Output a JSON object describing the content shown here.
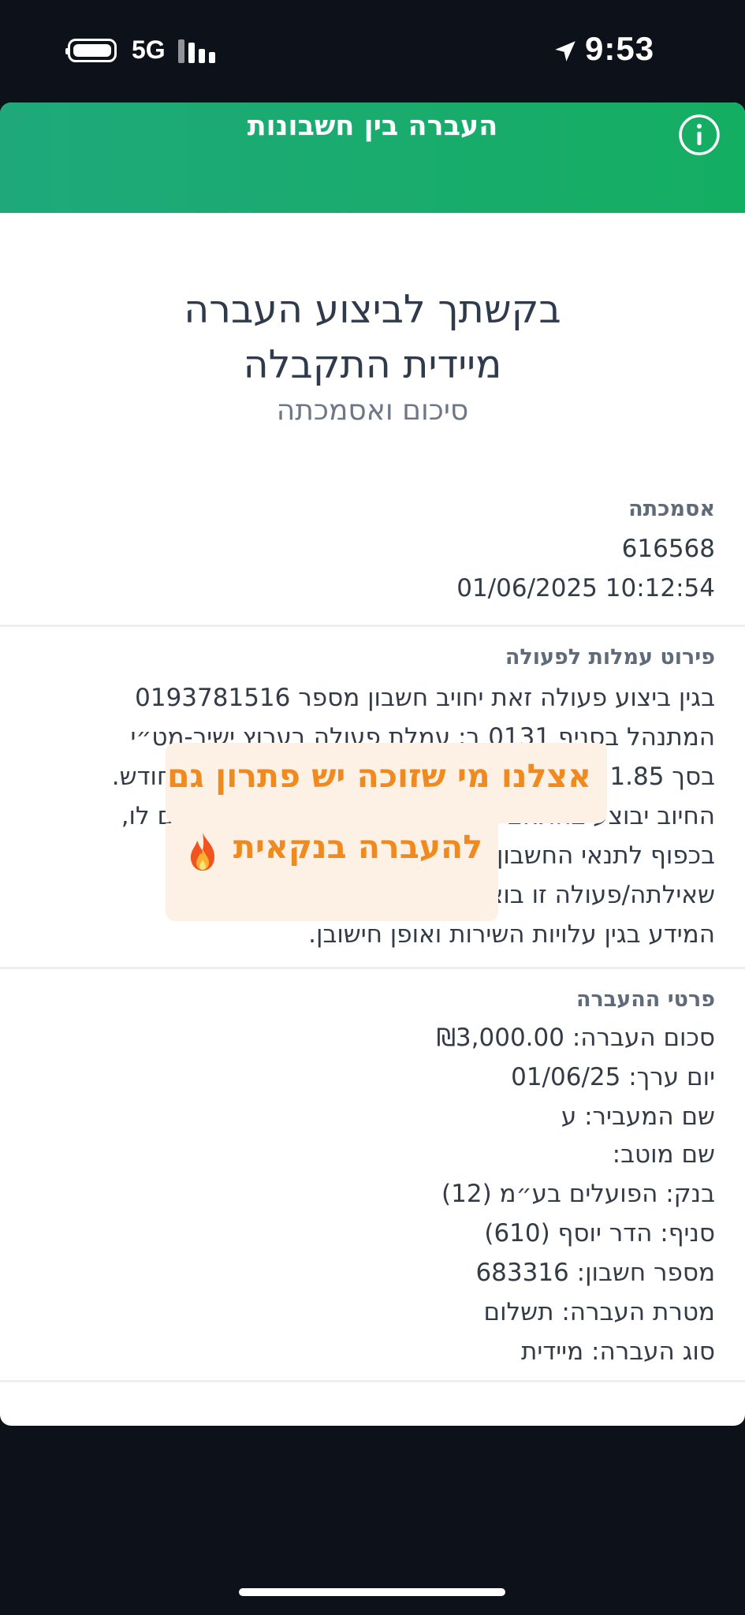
{
  "status_bar": {
    "network": "5G",
    "time": "9:53"
  },
  "header": {
    "title": "העברה בין חשבונות",
    "info_icon": "info-circle-icon"
  },
  "confirmation": {
    "headline_line1": "בקשתך לביצוע העברה",
    "headline_line2": "מיידית התקבלה",
    "subtitle": "סיכום ואסמכתה"
  },
  "reference": {
    "title": "אסמכתה",
    "number": "616568",
    "datetime": "01/06/2025 10:12:54"
  },
  "fees": {
    "title": "פירוט עמלות לפעולה",
    "lines": [
      "בגין ביצוע פעולה זאת יחויב חשבון מספר 0193781516",
      "המתנהל בסניף 0131 ב: עמלת פעולה בערוץ ישיר-מט״י",
      "בסך 1.85 ₪ בתחילת החודש הבא או ב-15 לחודש בחודש.",
      "החיוב יבוצע בהתאם לפעולה המבוצעת ולחודש שקדם לו,",
      "בכפוף לתנאי החשבון. אני מאשר/ת כי ביצעתי",
      "שאילתה/פעולה זו בוצעה באישורי כאחר שקיבלתי את",
      "המידע בגין עלויות השירות ואופן חישובן."
    ]
  },
  "promo": {
    "line1": "אצלנו מי שזוכה יש פתרון גם",
    "line2": "להעברה בנקאית",
    "emoji_icon": "fire-icon"
  },
  "transfer": {
    "title": "פרטי ההעברה",
    "amount": "סכום העברה: ₪3,000.00",
    "value_date": "יום ערך: 01/06/25",
    "sender": "שם המעביר: ע",
    "beneficiary": "שם מוטב:",
    "bank": "בנק: הפועלים בע״מ (12)",
    "branch": "סניף: הדר יוסף (610)",
    "account": "מספר חשבון: 683316",
    "purpose": "מטרת העברה: תשלום",
    "type": "סוג העברה: מיידית"
  },
  "colors": {
    "header_green": "#14ae62",
    "promo_orange": "#f08a1f",
    "promo_bg": "#fdf0e4",
    "screen_bg": "#0d1119"
  }
}
